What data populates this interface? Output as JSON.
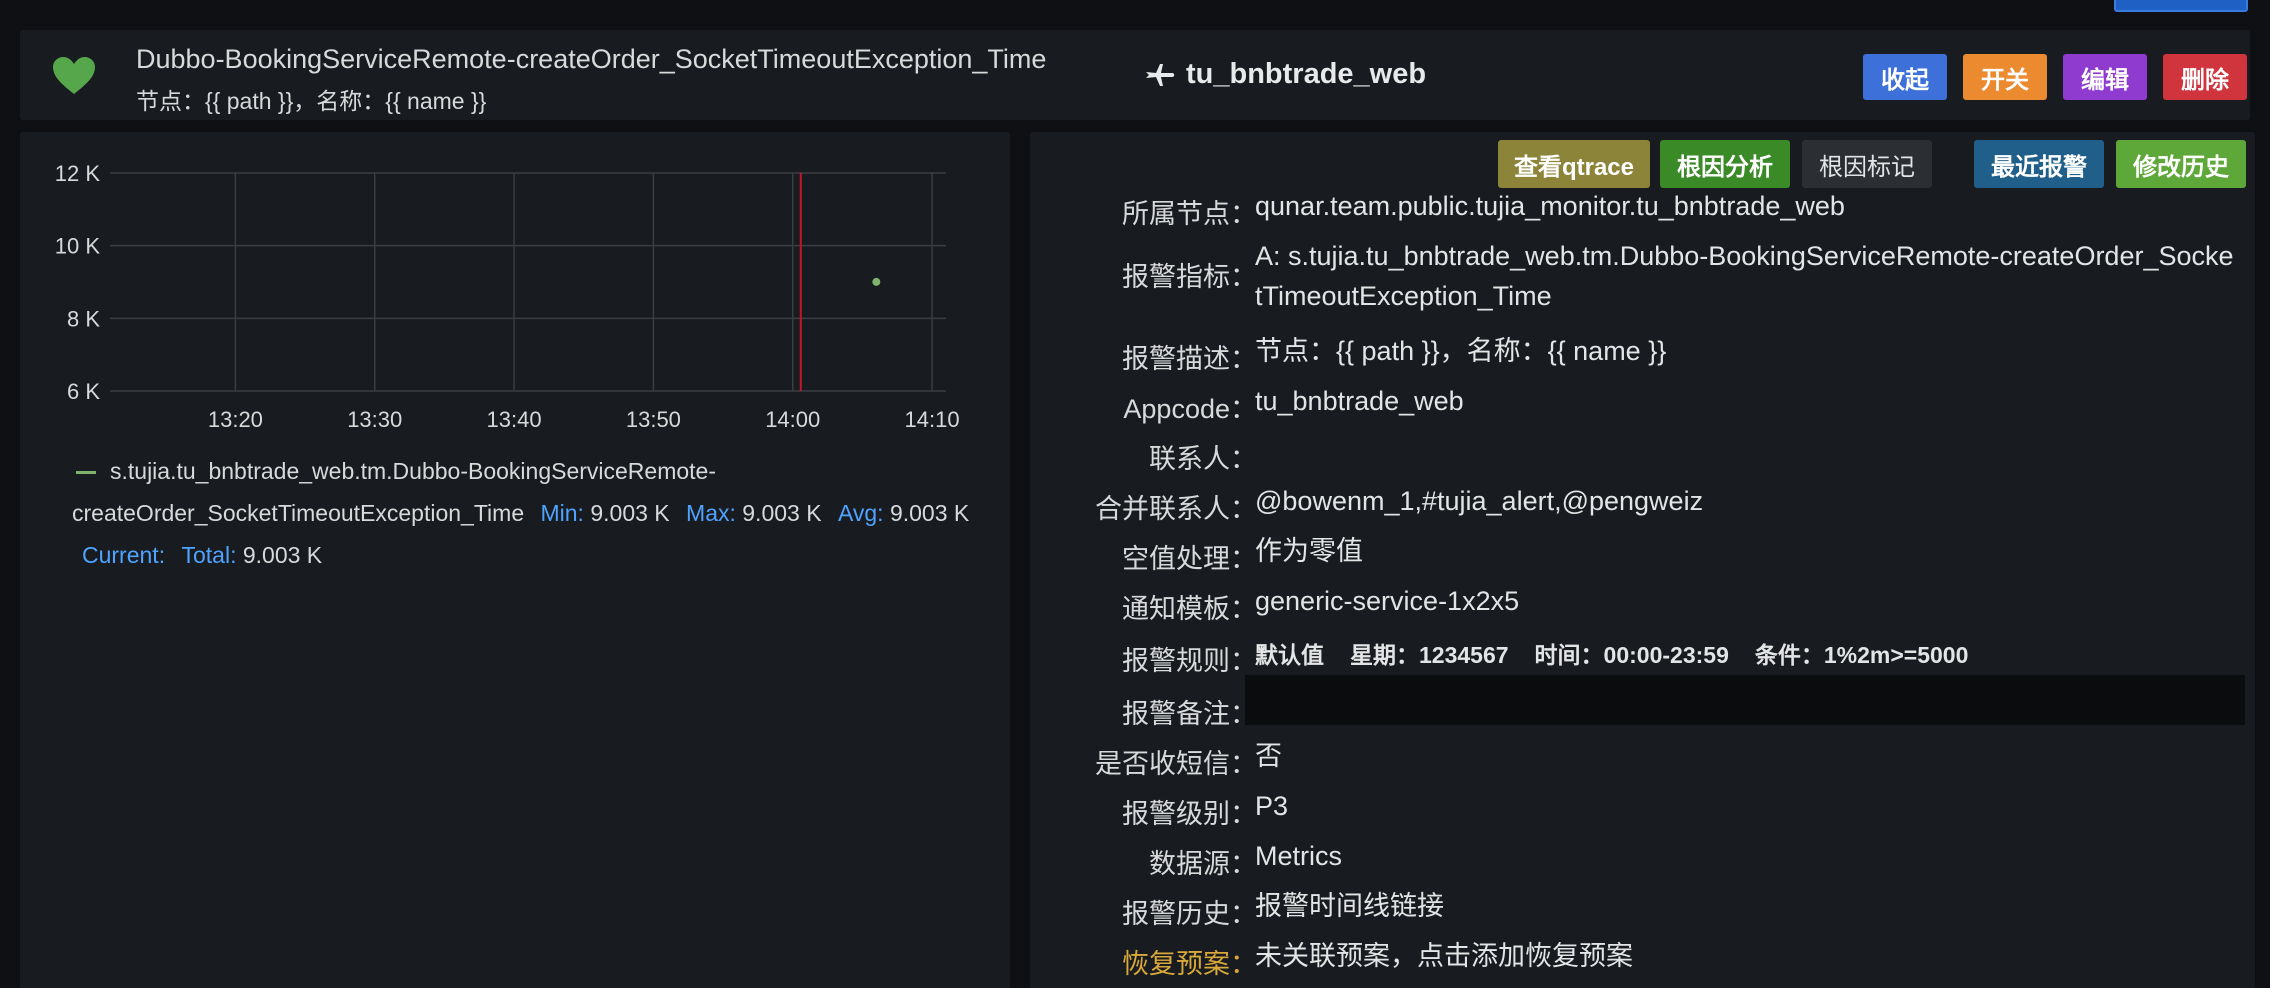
{
  "header": {
    "title": "Dubbo-BookingServiceRemote-createOrder_SocketTimeoutException_Time",
    "subtitle": "节点：{{ path }}，名称：{{ name }}",
    "app_name": "tu_bnbtrade_web",
    "status_icon": "heart-icon",
    "buttons": {
      "collapse": "收起",
      "toggle": "开关",
      "edit": "编辑",
      "delete": "删除"
    }
  },
  "colors": {
    "collapse": "#3d71d9",
    "toggle": "#eb8a2e",
    "edit": "#8f3bd0",
    "delete": "#d0343d",
    "qtrace": "#8c8438",
    "root_cause": "#3a8a28",
    "root_mark": "#2b2e33",
    "recent_alerts": "#1f5f8a",
    "modify_history": "#5ea83a",
    "series": "#7eb26d",
    "marker": "#c4162a"
  },
  "chart_data": {
    "type": "scatter",
    "x_ticks": [
      "13:20",
      "13:30",
      "13:40",
      "13:50",
      "14:00",
      "14:10"
    ],
    "y_ticks": [
      "6 K",
      "8 K",
      "10 K",
      "12 K"
    ],
    "ylim": [
      6000,
      12000
    ],
    "xlim": [
      "13:11",
      "14:11"
    ],
    "grid": true,
    "series": [
      {
        "name": "s.tujia.tu_bnbtrade_web.tm.Dubbo-BookingServiceRemote-createOrder_SocketTimeoutException_Time",
        "points": [
          {
            "x": "14:06",
            "y": 9003
          }
        ]
      }
    ],
    "annotations": [
      {
        "x": "14:00"
      }
    ]
  },
  "legend": {
    "series_name": "s.tujia.tu_bnbtrade_web.tm.Dubbo-BookingServiceRemote-createOrder_SocketTimeoutException_Time",
    "min_label": "Min:",
    "min_value": "9.003 K",
    "max_label": "Max:",
    "max_value": "9.003 K",
    "avg_label": "Avg:",
    "avg_value": "9.003 K",
    "current_label": "Current:",
    "current_value": "",
    "total_label": "Total:",
    "total_value": "9.003 K"
  },
  "detail_buttons": {
    "qtrace": "查看qtrace",
    "root_cause": "根因分析",
    "root_mark": "根因标记",
    "recent_alerts": "最近报警",
    "modify_history": "修改历史"
  },
  "details": {
    "node": {
      "label": "所属节点：",
      "value": "qunar.team.public.tujia_monitor.tu_bnbtrade_web"
    },
    "metric": {
      "label": "报警指标：",
      "value": "A: s.tujia.tu_bnbtrade_web.tm.Dubbo-BookingServiceRemote-createOrder_SocketTimeoutException_Time"
    },
    "description": {
      "label": "报警描述：",
      "value": "节点：{{ path }}，名称：{{ name }}"
    },
    "appcode": {
      "label": "Appcode：",
      "value": "tu_bnbtrade_web"
    },
    "contact": {
      "label": "联系人：",
      "value": ""
    },
    "merged_contact": {
      "label": "合并联系人：",
      "value": "@bowenm_1,#tujia_alert,@pengweiz"
    },
    "null_handling": {
      "label": "空值处理：",
      "value": "作为零值"
    },
    "notify_template": {
      "label": "通知模板：",
      "value": "generic-service-1x2x5"
    },
    "rule": {
      "label": "报警规则：",
      "default": "默认值",
      "week": "星期：1234567",
      "time": "时间：00:00-23:59",
      "condition": "条件：1%2m>=5000"
    },
    "note": {
      "label": "报警备注：",
      "value": ""
    },
    "sms": {
      "label": "是否收短信：",
      "value": "否"
    },
    "level": {
      "label": "报警级别：",
      "value": "P3"
    },
    "datasource": {
      "label": "数据源：",
      "value": "Metrics"
    },
    "history": {
      "label": "报警历史：",
      "value": "报警时间线链接"
    },
    "recovery": {
      "label": "恢复预案：",
      "value": "未关联预案，点击添加恢复预案"
    }
  }
}
